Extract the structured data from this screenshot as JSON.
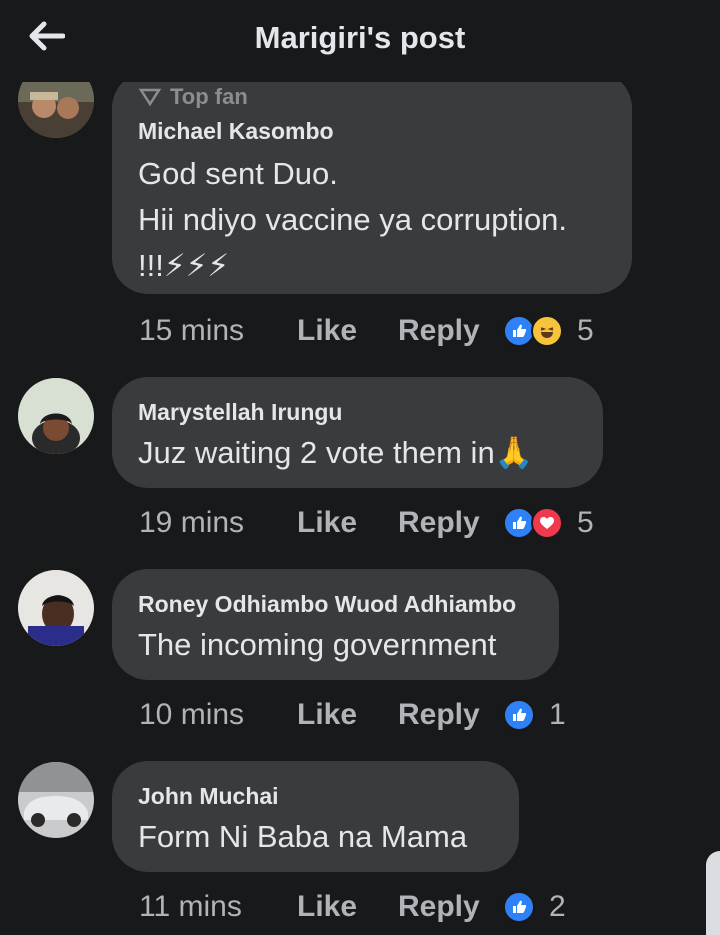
{
  "header": {
    "title": "Marigiri's post",
    "back_icon": "arrow-left-icon"
  },
  "colors": {
    "background": "#18191a",
    "bubble": "#3a3b3c",
    "like_blue": "#2e81f6",
    "love_red": "#f0384e",
    "haha_yellow": "#f7c33a"
  },
  "comments": [
    {
      "badge": "Top fan",
      "author": "Michael Kasombo",
      "lines": [
        "God sent Duo.",
        "Hii ndiyo vaccine ya corruption.",
        "!!!⚡⚡⚡"
      ],
      "time": "15 mins",
      "like_label": "Like",
      "reply_label": "Reply",
      "reactions": [
        "like",
        "haha"
      ],
      "reaction_count": "5"
    },
    {
      "author": "Marystellah Irungu",
      "lines": [
        "Juz waiting 2 vote them in🙏"
      ],
      "time": "19 mins",
      "like_label": "Like",
      "reply_label": "Reply",
      "reactions": [
        "like",
        "love"
      ],
      "reaction_count": "5"
    },
    {
      "author": "Roney Odhiambo Wuod Adhiambo",
      "lines": [
        "The incoming government"
      ],
      "time": "10 mins",
      "like_label": "Like",
      "reply_label": "Reply",
      "reactions": [
        "like"
      ],
      "reaction_count": "1"
    },
    {
      "author": "John Muchai",
      "lines": [
        "Form Ni Baba na Mama"
      ],
      "time": "11 mins",
      "like_label": "Like",
      "reply_label": "Reply",
      "reactions": [
        "like"
      ],
      "reaction_count": "2"
    }
  ]
}
